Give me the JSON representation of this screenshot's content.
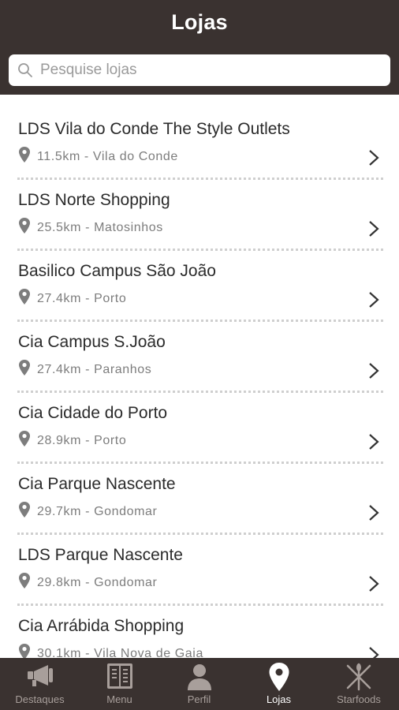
{
  "header": {
    "title": "Lojas"
  },
  "search": {
    "placeholder": "Pesquise lojas",
    "icon": "search-icon"
  },
  "stores": [
    {
      "name": "LDS Vila do Conde The Style Outlets",
      "distance": "11.5km",
      "city": "Vila do Conde",
      "meta": "11.5km - Vila do Conde"
    },
    {
      "name": "LDS Norte Shopping",
      "distance": "25.5km",
      "city": "Matosinhos",
      "meta": "25.5km - Matosinhos"
    },
    {
      "name": "Basilico Campus São João",
      "distance": "27.4km",
      "city": "Porto",
      "meta": "27.4km - Porto"
    },
    {
      "name": "Cia Campus S.João",
      "distance": "27.4km",
      "city": "Paranhos",
      "meta": "27.4km - Paranhos"
    },
    {
      "name": "Cia Cidade do Porto",
      "distance": "28.9km",
      "city": "Porto",
      "meta": "28.9km - Porto"
    },
    {
      "name": "Cia Parque Nascente",
      "distance": "29.7km",
      "city": "Gondomar",
      "meta": "29.7km - Gondomar"
    },
    {
      "name": "LDS Parque Nascente",
      "distance": "29.8km",
      "city": "Gondomar",
      "meta": "29.8km - Gondomar"
    },
    {
      "name": "Cia Arrábida Shopping",
      "distance": "30.1km",
      "city": "Vila Nova de Gaia",
      "meta": "30.1km - Vila Nova de Gaia"
    }
  ],
  "tabs": [
    {
      "label": "Destaques",
      "icon": "megaphone-icon",
      "active": false
    },
    {
      "label": "Menu",
      "icon": "menu-book-icon",
      "active": false
    },
    {
      "label": "Perfil",
      "icon": "person-icon",
      "active": false
    },
    {
      "label": "Lojas",
      "icon": "location-pin-icon",
      "active": true
    },
    {
      "label": "Starfoods",
      "icon": "cutlery-icon",
      "active": false
    }
  ],
  "colors": {
    "bar_background": "#3a3230",
    "text_primary": "#2b2b2b",
    "text_secondary": "#7d7d7d",
    "tab_inactive": "#a89f9b",
    "tab_active": "#ffffff"
  }
}
